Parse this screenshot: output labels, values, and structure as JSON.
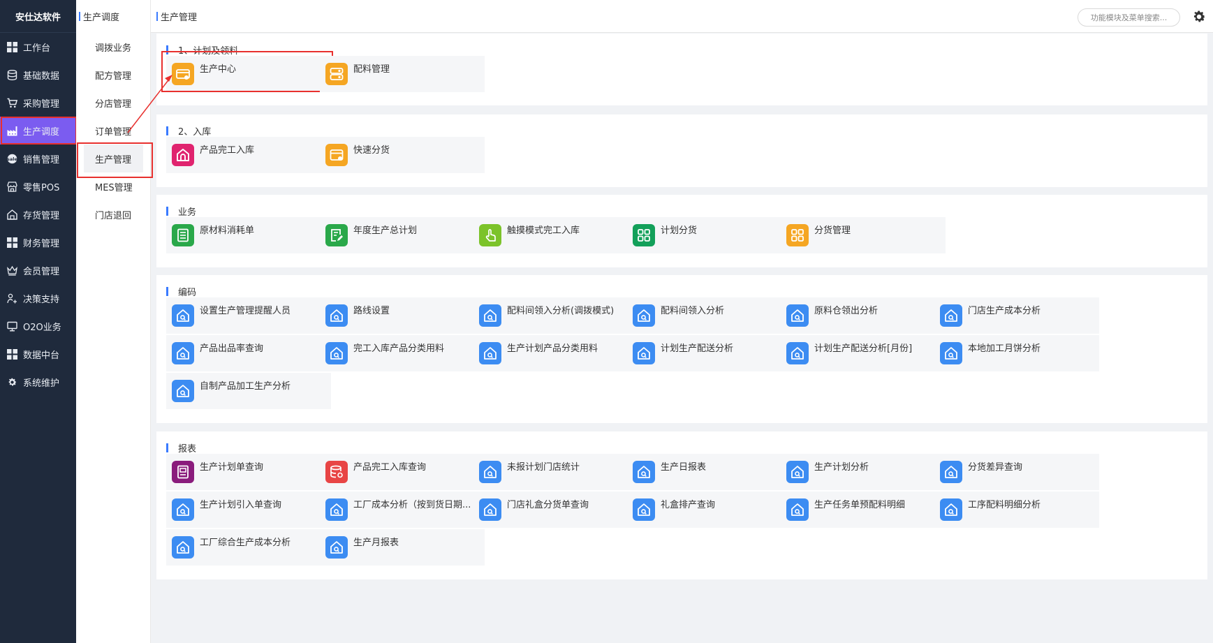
{
  "brand": "安仕达软件",
  "sidebar": {
    "items": [
      {
        "label": "工作台",
        "icon": "grid-icon"
      },
      {
        "label": "基础数据",
        "icon": "database-icon"
      },
      {
        "label": "采购管理",
        "icon": "cart-icon"
      },
      {
        "label": "生产调度",
        "icon": "factory-icon",
        "active": true
      },
      {
        "label": "销售管理",
        "icon": "sale-icon"
      },
      {
        "label": "零售POS",
        "icon": "store-icon"
      },
      {
        "label": "存货管理",
        "icon": "warehouse-icon"
      },
      {
        "label": "财务管理",
        "icon": "grid-icon"
      },
      {
        "label": "会员管理",
        "icon": "crown-icon"
      },
      {
        "label": "决策支持",
        "icon": "decision-icon"
      },
      {
        "label": "O2O业务",
        "icon": "monitor-icon"
      },
      {
        "label": "数据中台",
        "icon": "grid-icon"
      },
      {
        "label": "系统维护",
        "icon": "gear-icon"
      }
    ]
  },
  "submenu": {
    "title": "生产调度",
    "items": [
      {
        "label": "调拨业务"
      },
      {
        "label": "配方管理"
      },
      {
        "label": "分店管理"
      },
      {
        "label": "订单管理"
      },
      {
        "label": "生产管理",
        "active": true
      },
      {
        "label": "MES管理"
      },
      {
        "label": "门店退回"
      }
    ]
  },
  "tabbar": {
    "title": "生产管理",
    "search_placeholder": "功能模块及菜单搜索..."
  },
  "colors": {
    "sidebar_bg": "#1f2a3c",
    "active_purple": "#7b5cf0",
    "accent_blue": "#3a7bff",
    "highlight_red": "#e8302e",
    "orange": "#f5a623",
    "pink": "#e0246f",
    "green": "#2aa84a",
    "lime": "#7cc32a",
    "teal_green": "#13a05a",
    "purple": "#8a1c7c",
    "red": "#e84545",
    "blue": "#3c8cf2"
  },
  "sections": [
    {
      "title": "1、计划及领料",
      "cards": [
        {
          "label": "生产中心",
          "icon": "production-center-icon",
          "color": "#f5a623",
          "highlight": true
        },
        {
          "label": "配料管理",
          "icon": "ingredient-icon",
          "color": "#f5a623"
        }
      ]
    },
    {
      "title": "2、入库",
      "cards": [
        {
          "label": "产品完工入库",
          "icon": "home-stock-icon",
          "color": "#e0246f"
        },
        {
          "label": "快速分货",
          "icon": "quick-distribute-icon",
          "color": "#f5a623"
        }
      ]
    },
    {
      "title": "业务",
      "cards": [
        {
          "label": "原材料消耗单",
          "icon": "list-doc-icon",
          "color": "#2aa84a"
        },
        {
          "label": "年度生产总计划",
          "icon": "edit-doc-icon",
          "color": "#2aa84a"
        },
        {
          "label": "触摸模式完工入库",
          "icon": "touch-icon",
          "color": "#7cc32a"
        },
        {
          "label": "计划分货",
          "icon": "apps-icon",
          "color": "#13a05a"
        },
        {
          "label": "分货管理",
          "icon": "apps-icon",
          "color": "#f5a623"
        }
      ]
    },
    {
      "title": "编码",
      "cards": [
        {
          "label": "设置生产管理提醒人员",
          "icon": "house-search-icon",
          "color": "#3c8cf2"
        },
        {
          "label": "路线设置",
          "icon": "house-search-icon",
          "color": "#3c8cf2"
        },
        {
          "label": "配料间领入分析(调拨模式)",
          "icon": "house-search-icon",
          "color": "#3c8cf2"
        },
        {
          "label": "配料间领入分析",
          "icon": "house-search-icon",
          "color": "#3c8cf2"
        },
        {
          "label": "原料仓领出分析",
          "icon": "house-search-icon",
          "color": "#3c8cf2"
        },
        {
          "label": "门店生产成本分析",
          "icon": "house-search-icon",
          "color": "#3c8cf2"
        },
        {
          "label": "产品出品率查询",
          "icon": "house-search-icon",
          "color": "#3c8cf2"
        },
        {
          "label": "完工入库产品分类用料",
          "icon": "house-search-icon",
          "color": "#3c8cf2"
        },
        {
          "label": "生产计划产品分类用料",
          "icon": "house-search-icon",
          "color": "#3c8cf2"
        },
        {
          "label": "计划生产配送分析",
          "icon": "house-search-icon",
          "color": "#3c8cf2"
        },
        {
          "label": "计划生产配送分析[月份]",
          "icon": "house-search-icon",
          "color": "#3c8cf2"
        },
        {
          "label": "本地加工月饼分析",
          "icon": "house-search-icon",
          "color": "#3c8cf2"
        },
        {
          "label": "自制产品加工生产分析",
          "icon": "house-search-icon",
          "color": "#3c8cf2"
        }
      ]
    },
    {
      "title": "报表",
      "cards": [
        {
          "label": "生产计划单查询",
          "icon": "plan-doc-icon",
          "color": "#8a1c7c"
        },
        {
          "label": "产品完工入库查询",
          "icon": "db-search-icon",
          "color": "#e84545"
        },
        {
          "label": "未报计划门店统计",
          "icon": "house-search-icon",
          "color": "#3c8cf2"
        },
        {
          "label": "生产日报表",
          "icon": "house-search-icon",
          "color": "#3c8cf2"
        },
        {
          "label": "生产计划分析",
          "icon": "house-search-icon",
          "color": "#3c8cf2"
        },
        {
          "label": "分货差异查询",
          "icon": "house-search-icon",
          "color": "#3c8cf2"
        },
        {
          "label": "生产计划引入单查询",
          "icon": "house-search-icon",
          "color": "#3c8cf2"
        },
        {
          "label": "工厂成本分析（按到货日期...",
          "icon": "house-search-icon",
          "color": "#3c8cf2"
        },
        {
          "label": "门店礼盒分货单查询",
          "icon": "house-search-icon",
          "color": "#3c8cf2"
        },
        {
          "label": "礼盒排产查询",
          "icon": "house-search-icon",
          "color": "#3c8cf2"
        },
        {
          "label": "生产任务单预配料明细",
          "icon": "house-search-icon",
          "color": "#3c8cf2"
        },
        {
          "label": "工序配料明细分析",
          "icon": "house-search-icon",
          "color": "#3c8cf2"
        },
        {
          "label": "工厂综合生产成本分析",
          "icon": "house-search-icon",
          "color": "#3c8cf2"
        },
        {
          "label": "生产月报表",
          "icon": "house-search-icon",
          "color": "#3c8cf2"
        }
      ]
    }
  ]
}
